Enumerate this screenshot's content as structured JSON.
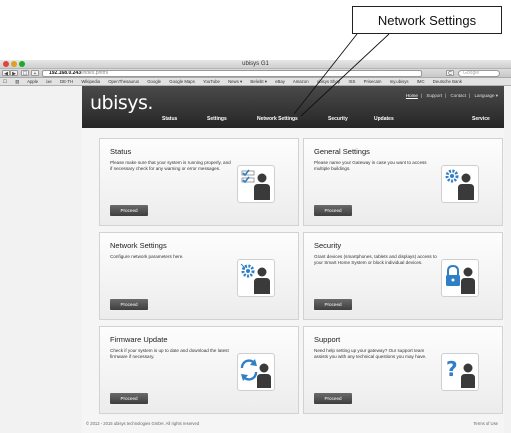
{
  "callout": {
    "label": "Network Settings"
  },
  "browser": {
    "window_title": "ubisys G1",
    "url_host": "192.168.0.243",
    "url_path": "/index.phtml",
    "search_placeholder": "Google",
    "bookmarks": [
      "Apple",
      "ixe",
      "DE-TH",
      "Wikipedia",
      "OpenThesaurus",
      "Google",
      "Google Maps",
      "YouTube",
      "News ▾",
      "Beliebt ▾",
      "eBay",
      "Amazon",
      "ubisys Shop",
      "ISS",
      "Prisecam",
      "my.ubisys",
      "IMC",
      "Deutsche Bank"
    ]
  },
  "site": {
    "logo": "ubisys.",
    "toplinks": {
      "home": "Home",
      "support": "Support",
      "contact": "Contact",
      "language": "Language ▾"
    },
    "nav": [
      "Status",
      "Settings",
      "Network Settings",
      "Security",
      "Updates",
      "Service"
    ],
    "cards": [
      {
        "title": "Status",
        "desc": "Please make sure that your system is running properly, and if necessary check for any warning or error messages.",
        "button": "Proceed",
        "icon": "status-check-icon"
      },
      {
        "title": "General Settings",
        "desc": "Please name your Gateway in case you want to access multiple buildings.",
        "button": "Proceed",
        "icon": "gear-user-icon"
      },
      {
        "title": "Network Settings",
        "desc": "Configure network parameters here.",
        "button": "Proceed",
        "icon": "network-gear-icon"
      },
      {
        "title": "Security",
        "desc": "Grant devices (smartphones, tablets and displays) access to your Smart Home System or block individual devices.",
        "button": "Proceed",
        "icon": "lock-user-icon"
      },
      {
        "title": "Firmware Update",
        "desc": "Check if your system is up to date and download the latest firmware if necessary.",
        "button": "Proceed",
        "icon": "refresh-user-icon"
      },
      {
        "title": "Support",
        "desc": "Need help setting up your gateway? Our support team assists you with any technical questions you may have.",
        "button": "Proceed",
        "icon": "question-user-icon"
      }
    ],
    "footer_left": "© 2012 - 2015 ubisys technologies GmbH. All rights reserved",
    "footer_right": "Terms of Use"
  },
  "colors": {
    "header": "#2b2b2b",
    "button": "#4a4a4a",
    "accent_blue": "#2f7fc6"
  }
}
